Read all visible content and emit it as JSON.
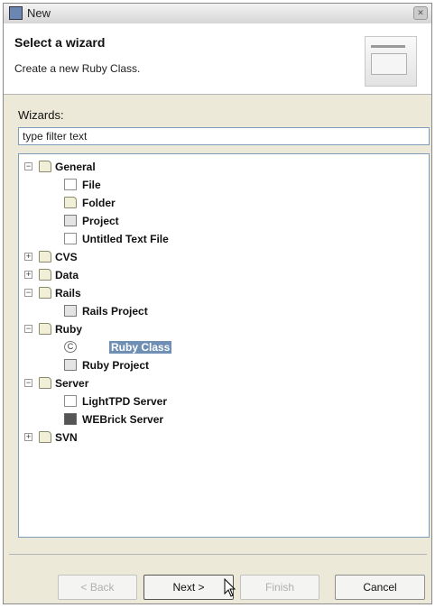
{
  "window": {
    "title": "New"
  },
  "header": {
    "title": "Select a wizard",
    "description": "Create a new Ruby Class."
  },
  "wizards": {
    "label": "Wizards:",
    "filter_placeholder": "type filter text"
  },
  "tree": {
    "general": {
      "label": "General",
      "toggle": "−"
    },
    "file": {
      "label": "File"
    },
    "folder": {
      "label": "Folder"
    },
    "project": {
      "label": "Project"
    },
    "untitled_text_file": {
      "label": "Untitled Text File"
    },
    "cvs": {
      "label": "CVS",
      "toggle": "+"
    },
    "data": {
      "label": "Data",
      "toggle": "+"
    },
    "rails": {
      "label": "Rails",
      "toggle": "−"
    },
    "rails_project": {
      "label": "Rails Project"
    },
    "ruby": {
      "label": "Ruby",
      "toggle": "−"
    },
    "ruby_class": {
      "label": "Ruby Class",
      "selected": true
    },
    "ruby_project": {
      "label": "Ruby Project"
    },
    "server": {
      "label": "Server",
      "toggle": "−"
    },
    "lighttpd_server": {
      "label": "LightTPD Server"
    },
    "webrick_server": {
      "label": "WEBrick Server"
    },
    "svn": {
      "label": "SVN",
      "toggle": "+"
    }
  },
  "buttons": {
    "back": {
      "label": "< Back",
      "enabled": false
    },
    "next": {
      "label": "Next >",
      "enabled": true
    },
    "finish": {
      "label": "Finish",
      "enabled": false
    },
    "cancel": {
      "label": "Cancel",
      "enabled": true
    }
  },
  "colors": {
    "selection": "#6f8fb4",
    "header_bg": "#ffffff",
    "dialog_bg": "#ece9d8"
  }
}
